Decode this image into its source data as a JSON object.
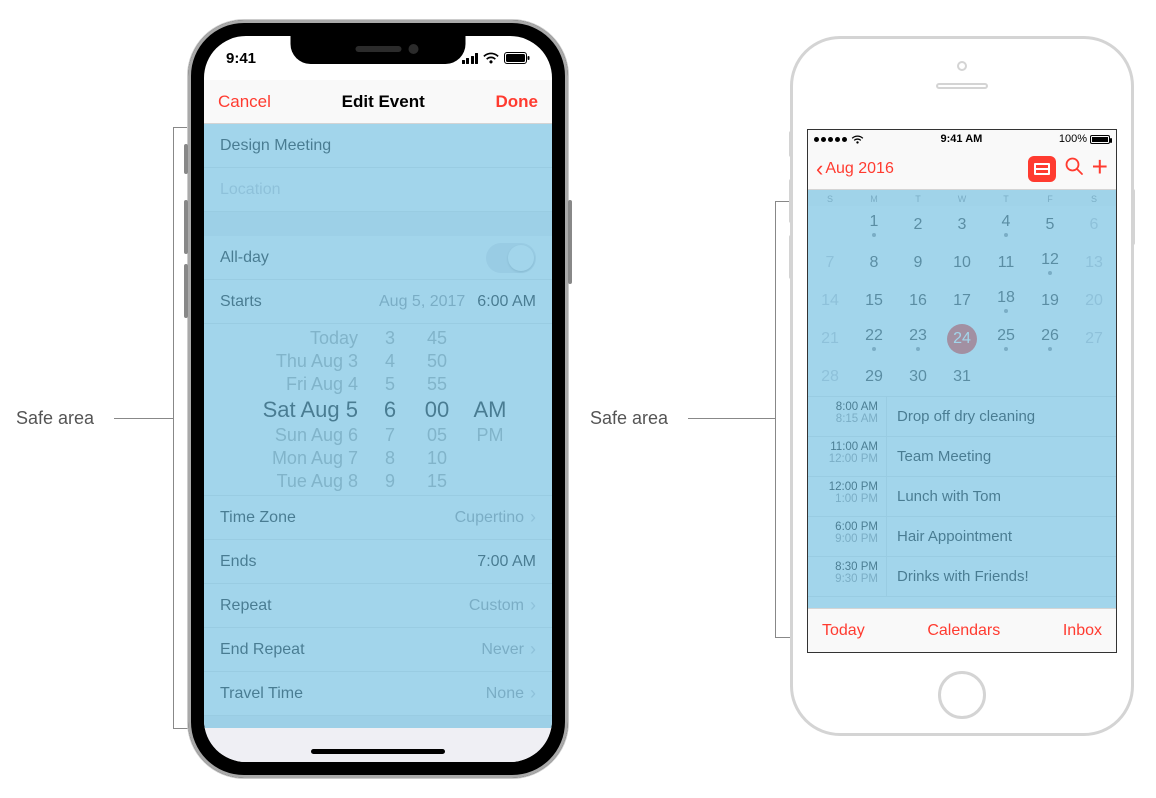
{
  "callouts": {
    "left": "Safe area",
    "right": "Safe area"
  },
  "phoneX": {
    "status": {
      "time": "9:41"
    },
    "nav": {
      "left": "Cancel",
      "title": "Edit Event",
      "right": "Done"
    },
    "fields": {
      "title_value": "Design Meeting",
      "location_ph": "Location",
      "allday_label": "All-day",
      "starts_label": "Starts",
      "starts_date": "Aug 5, 2017",
      "starts_time": "6:00 AM",
      "timezone_label": "Time Zone",
      "timezone_value": "Cupertino",
      "ends_label": "Ends",
      "ends_value": "7:00 AM",
      "repeat_label": "Repeat",
      "repeat_value": "Custom",
      "endrepeat_label": "End Repeat",
      "endrepeat_value": "Never",
      "travel_label": "Travel Time",
      "travel_value": "None"
    },
    "picker": [
      {
        "d": "Today",
        "h": "3",
        "m": "45",
        "a": ""
      },
      {
        "d": "Thu Aug 3",
        "h": "4",
        "m": "50",
        "a": ""
      },
      {
        "d": "Fri Aug 4",
        "h": "5",
        "m": "55",
        "a": ""
      },
      {
        "d": "Sat Aug 5",
        "h": "6",
        "m": "00",
        "a": "AM"
      },
      {
        "d": "Sun Aug 6",
        "h": "7",
        "m": "05",
        "a": "PM"
      },
      {
        "d": "Mon Aug 7",
        "h": "8",
        "m": "10",
        "a": ""
      },
      {
        "d": "Tue Aug 8",
        "h": "9",
        "m": "15",
        "a": ""
      }
    ]
  },
  "phone6": {
    "status": {
      "time": "9:41 AM",
      "battery": "100%"
    },
    "nav": {
      "back": "Aug 2016"
    },
    "weekdays": [
      "S",
      "M",
      "T",
      "W",
      "T",
      "F",
      "S"
    ],
    "month": {
      "start_offset": 1,
      "days": 31,
      "selected": 24,
      "dim": [
        6,
        7,
        13,
        14,
        20,
        21,
        27,
        28
      ],
      "dots": [
        1,
        4,
        12,
        18,
        22,
        23,
        25,
        26
      ]
    },
    "agenda": [
      {
        "t1": "8:00 AM",
        "t2": "8:15 AM",
        "title": "Drop off dry cleaning"
      },
      {
        "t1": "11:00 AM",
        "t2": "12:00 PM",
        "title": "Team Meeting"
      },
      {
        "t1": "12:00 PM",
        "t2": "1:00 PM",
        "title": "Lunch with Tom"
      },
      {
        "t1": "6:00 PM",
        "t2": "9:00 PM",
        "title": "Hair Appointment"
      },
      {
        "t1": "8:30 PM",
        "t2": "9:30 PM",
        "title": "Drinks with Friends!"
      }
    ],
    "tabs": {
      "today": "Today",
      "calendars": "Calendars",
      "inbox": "Inbox"
    }
  }
}
